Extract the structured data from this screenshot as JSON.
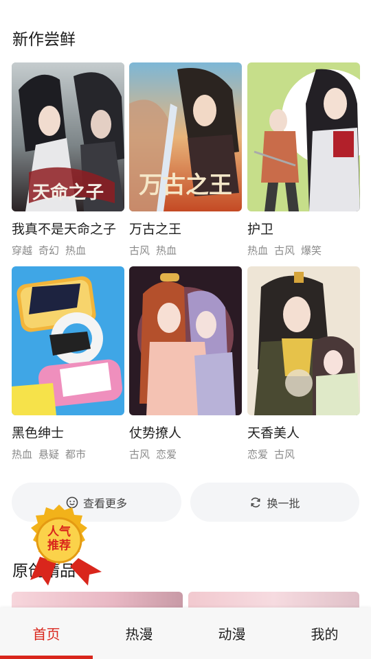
{
  "new_section": {
    "title": "新作尝鲜",
    "comics": [
      {
        "title": "我真不是天命之子",
        "tags": [
          "穿越",
          "奇幻",
          "热血"
        ]
      },
      {
        "title": "万古之王",
        "tags": [
          "古风",
          "热血"
        ]
      },
      {
        "title": "护卫",
        "tags": [
          "热血",
          "古风",
          "爆笑"
        ]
      },
      {
        "title": "黑色绅士",
        "tags": [
          "热血",
          "悬疑",
          "都市"
        ]
      },
      {
        "title": "仗势撩人",
        "tags": [
          "古风",
          "恋爱"
        ]
      },
      {
        "title": "天香美人",
        "tags": [
          "恋爱",
          "古风"
        ]
      }
    ],
    "more_label": "查看更多",
    "refresh_label": "换一批"
  },
  "badge": {
    "text": "人气推荐"
  },
  "original_section": {
    "title": "原创精品"
  },
  "tabs": [
    {
      "label": "首页",
      "active": true
    },
    {
      "label": "热漫",
      "active": false
    },
    {
      "label": "动漫",
      "active": false
    },
    {
      "label": "我的",
      "active": false
    }
  ],
  "colors": {
    "accent": "#d9261c",
    "button_bg": "#f4f5f7",
    "tag_text": "#8a8a8a"
  }
}
